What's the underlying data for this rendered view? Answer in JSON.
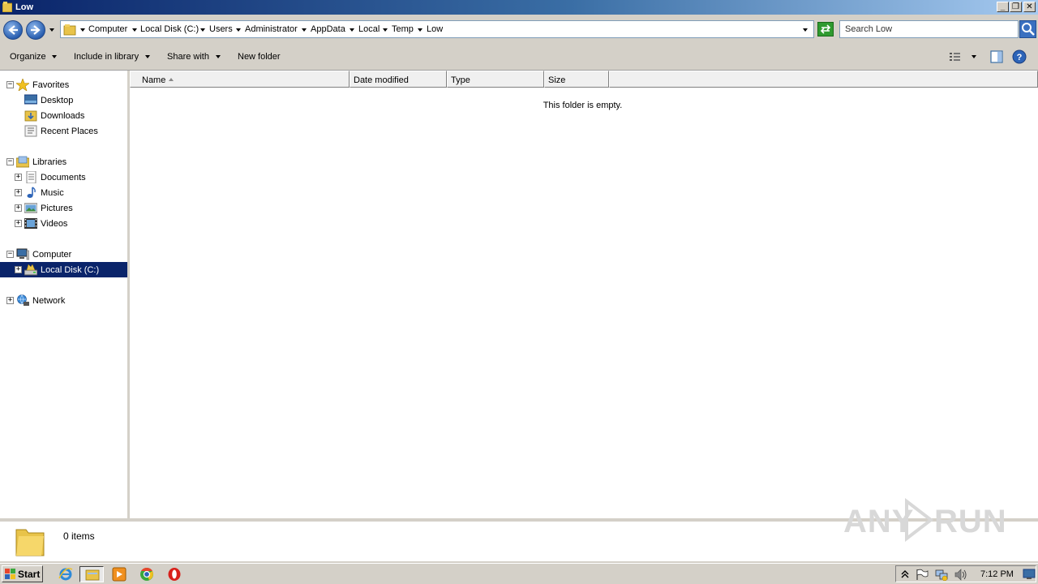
{
  "window": {
    "title": "Low"
  },
  "nav": {
    "breadcrumbs": [
      "Computer",
      "Local Disk (C:)",
      "Users",
      "Administrator",
      "AppData",
      "Local",
      "Temp",
      "Low"
    ],
    "search_placeholder": "Search Low"
  },
  "toolbar": {
    "organize": "Organize",
    "include_in_library": "Include in library",
    "share_with": "Share with",
    "new_folder": "New folder"
  },
  "sidebar": {
    "favorites": {
      "label": "Favorites",
      "items": [
        "Desktop",
        "Downloads",
        "Recent Places"
      ]
    },
    "libraries": {
      "label": "Libraries",
      "items": [
        "Documents",
        "Music",
        "Pictures",
        "Videos"
      ]
    },
    "computer": {
      "label": "Computer",
      "items": [
        "Local Disk (C:)"
      ]
    },
    "network": {
      "label": "Network"
    }
  },
  "columns": [
    "Name",
    "Date modified",
    "Type",
    "Size"
  ],
  "content": {
    "empty_message": "This folder is empty."
  },
  "status": {
    "count": "0 items"
  },
  "watermark": "ANY RUN",
  "taskbar": {
    "start": "Start",
    "clock": "7:12 PM"
  },
  "colors": {
    "selection": "#0a246a",
    "chrome": "#d4d0c8"
  }
}
